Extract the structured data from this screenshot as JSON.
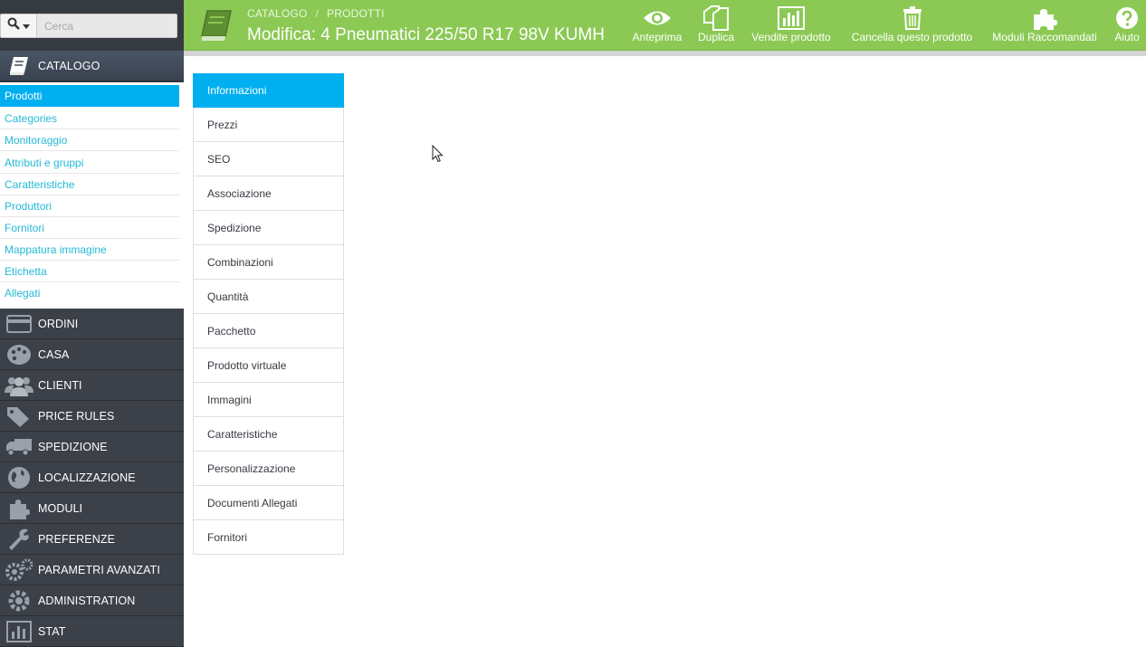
{
  "colors": {
    "header_green": "#8bc954",
    "accent_blue": "#00aff0",
    "link_blue": "#25b9d7",
    "sidebar_dark": "#363a41"
  },
  "search": {
    "placeholder": "Cerca",
    "icon": "search-icon"
  },
  "sidebar": {
    "active_section": {
      "label": "CATALOGO",
      "icon": "book-icon"
    },
    "submenu": [
      {
        "label": "Prodotti",
        "active": true
      },
      {
        "label": "Categories"
      },
      {
        "label": "Monitoraggio"
      },
      {
        "label": "Attributi e gruppi"
      },
      {
        "label": "Caratteristiche"
      },
      {
        "label": "Produttori"
      },
      {
        "label": "Fornitori"
      },
      {
        "label": "Mappatura immagine"
      },
      {
        "label": "Etichetta"
      },
      {
        "label": "Allegati"
      }
    ],
    "sections": [
      {
        "label": "ORDINI",
        "icon": "credit-card-icon"
      },
      {
        "label": "CASA",
        "icon": "palette-icon"
      },
      {
        "label": "CLIENTI",
        "icon": "users-icon"
      },
      {
        "label": "PRICE RULES",
        "icon": "tags-icon"
      },
      {
        "label": "SPEDIZIONE",
        "icon": "truck-icon"
      },
      {
        "label": "LOCALIZZAZIONE",
        "icon": "globe-icon"
      },
      {
        "label": "MODULI",
        "icon": "puzzle-icon"
      },
      {
        "label": "PREFERENZE",
        "icon": "wrench-icon"
      },
      {
        "label": "PARAMETRI AVANZATI",
        "icon": "cogs-icon"
      },
      {
        "label": "ADMINISTRATION",
        "icon": "cog-icon"
      },
      {
        "label": "STAT",
        "icon": "bar-chart-icon"
      }
    ]
  },
  "header": {
    "breadcrumb": [
      "CATALOGO",
      "PRODOTTI"
    ],
    "breadcrumb_separator": "/",
    "title": "Modifica: 4 Pneumatici 225/50 R17 98V KUMH",
    "toolbar": [
      {
        "label": "Anteprima",
        "icon": "eye-icon"
      },
      {
        "label": "Duplica",
        "icon": "copy-icon"
      },
      {
        "label": "Vendite prodotto",
        "icon": "bar-chart-icon"
      },
      {
        "label": "Cancella questo prodotto",
        "icon": "trash-icon"
      },
      {
        "label": "Moduli Raccomandati",
        "icon": "puzzle-icon"
      },
      {
        "label": "Aiuto",
        "icon": "question-icon"
      }
    ]
  },
  "tabs": [
    {
      "label": "Informazioni",
      "active": true
    },
    {
      "label": "Prezzi"
    },
    {
      "label": "SEO"
    },
    {
      "label": "Associazione"
    },
    {
      "label": "Spedizione"
    },
    {
      "label": "Combinazioni"
    },
    {
      "label": "Quantità"
    },
    {
      "label": "Pacchetto"
    },
    {
      "label": "Prodotto virtuale"
    },
    {
      "label": "Immagini"
    },
    {
      "label": "Caratteristiche"
    },
    {
      "label": "Personalizzazione"
    },
    {
      "label": "Documenti Allegati"
    },
    {
      "label": "Fornitori"
    }
  ]
}
